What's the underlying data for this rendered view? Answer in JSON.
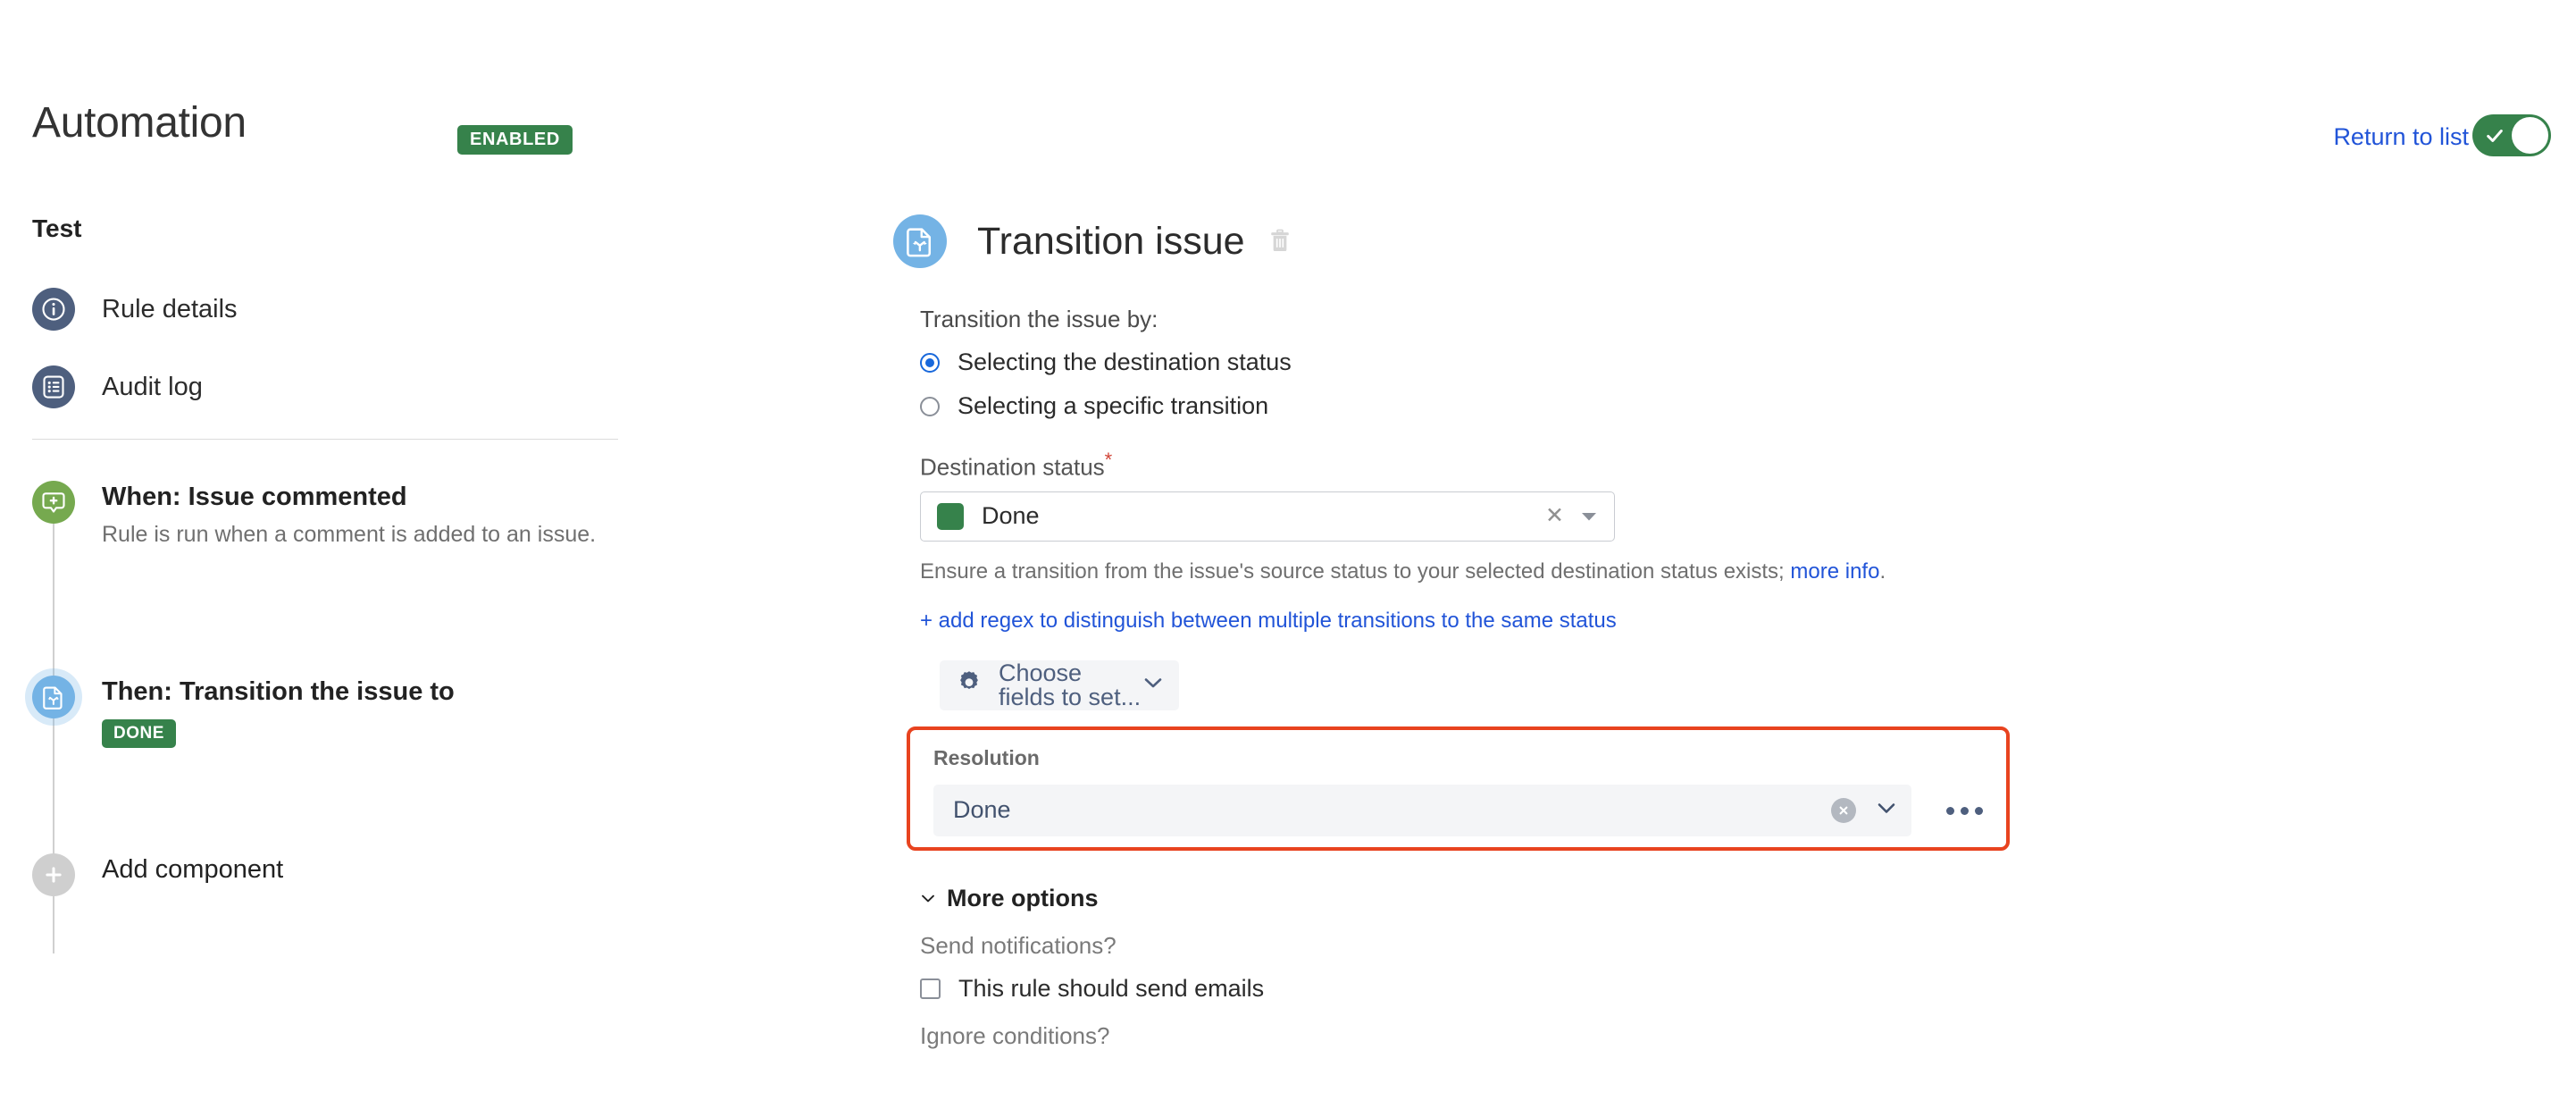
{
  "header": {
    "app_title": "Automation",
    "status_badge": "ENABLED",
    "return_link": "Return to list",
    "toggle_state": "on",
    "enabled_color": "#36824b",
    "link_color": "#2154d8"
  },
  "sidebar": {
    "rule_name": "Test",
    "nav": [
      {
        "label": "Rule details",
        "icon": "info-icon"
      },
      {
        "label": "Audit log",
        "icon": "list-document-icon"
      }
    ],
    "timeline": [
      {
        "title": "When: Issue commented",
        "description": "Rule is run when a comment is added to an issue.",
        "icon": "comment-add-icon",
        "icon_color": "#76a94f",
        "badge": null
      },
      {
        "title": "Then: Transition the issue to",
        "description": null,
        "icon": "transition-issue-icon",
        "icon_color": "#74b3e5",
        "badge": "DONE",
        "badge_color": "#36824b"
      },
      {
        "title": "Add component",
        "description": null,
        "icon": "plus-icon",
        "icon_color": "#cfcfcf",
        "badge": null
      }
    ]
  },
  "main": {
    "title": "Transition issue",
    "icon": "transition-issue-icon",
    "delete_icon": "trash-icon",
    "transition_by_label": "Transition the issue by:",
    "radios": [
      {
        "label": "Selecting the destination status",
        "checked": true
      },
      {
        "label": "Selecting a specific transition",
        "checked": false
      }
    ],
    "destination_status": {
      "label": "Destination status",
      "required_marker": "*",
      "value": "Done",
      "swatch_color": "#36824b",
      "clear_icon": "clear-icon",
      "caret_icon": "caret-down-icon"
    },
    "help_text_before": "Ensure a transition from the issue's source status to your selected destination status exists; ",
    "help_link": "more info",
    "help_text_after": ".",
    "regex_link": "+ add regex to distinguish between multiple transitions to the same status",
    "choose_fields": {
      "label": "Choose fields to set...",
      "icon": "gear-icon",
      "caret_icon": "chevron-down-icon"
    },
    "resolution": {
      "label": "Resolution",
      "value": "Done",
      "clear_icon": "clear-circle-icon",
      "caret_icon": "chevron-down-icon",
      "more_icon": "more-horizontal-icon",
      "highlight_color": "#e8431f"
    },
    "more_options": {
      "label": "More options",
      "caret_icon": "chevron-down-icon",
      "send_notifications_label": "Send notifications?",
      "send_emails_checkbox": "This rule should send emails",
      "send_emails_checked": false,
      "ignore_conditions_label": "Ignore conditions?"
    }
  }
}
